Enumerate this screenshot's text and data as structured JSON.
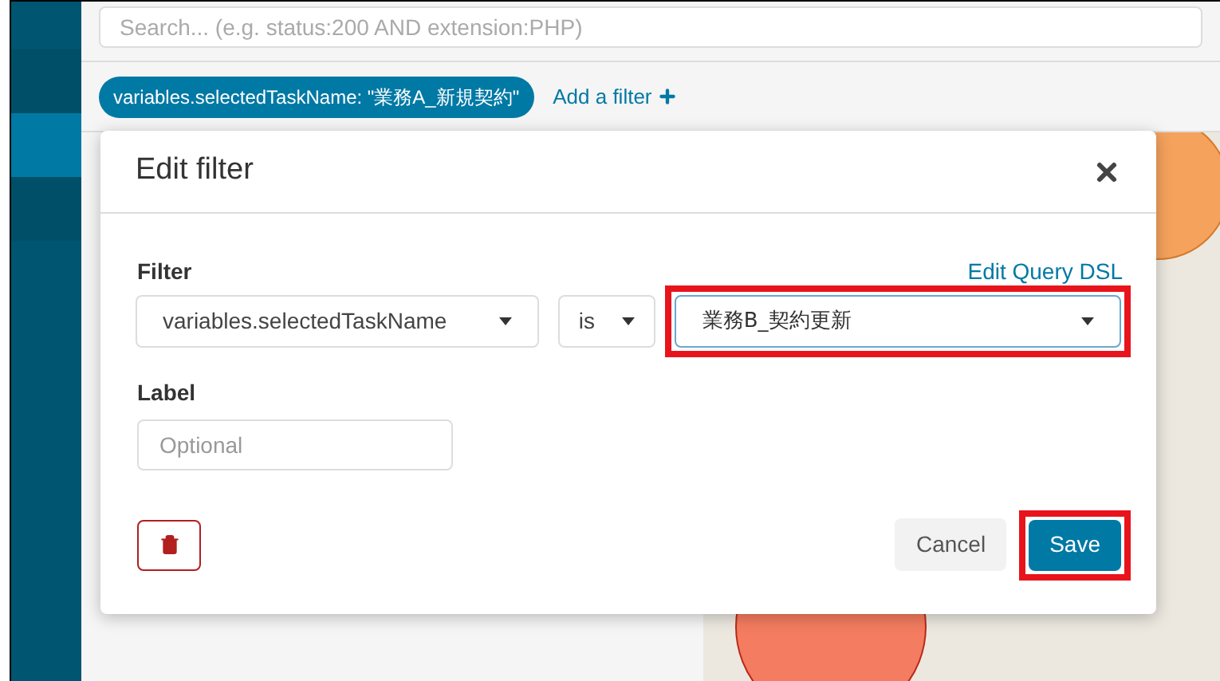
{
  "search": {
    "placeholder": "Search... (e.g. status:200 AND extension:PHP)"
  },
  "filter_bar": {
    "pill": "variables.selectedTaskName: \"業務A_新規契約\"",
    "add_filter": "Add a filter"
  },
  "sidebar": {
    "items": [
      {
        "selected": false
      },
      {
        "selected": true
      },
      {
        "selected": false
      }
    ]
  },
  "dialog": {
    "title": "Edit filter",
    "filter_label": "Filter",
    "edit_dsl": "Edit Query DSL",
    "field": {
      "value": "variables.selectedTaskName",
      "highlighted": false
    },
    "operator": {
      "value": "is",
      "highlighted": false
    },
    "value": {
      "value": "業務B_契約更新",
      "highlighted": true
    },
    "label_label": "Label",
    "label_input": {
      "placeholder": "Optional"
    },
    "cancel": {
      "label": "Cancel",
      "highlighted": false
    },
    "save": {
      "label": "Save",
      "highlighted": true
    }
  }
}
